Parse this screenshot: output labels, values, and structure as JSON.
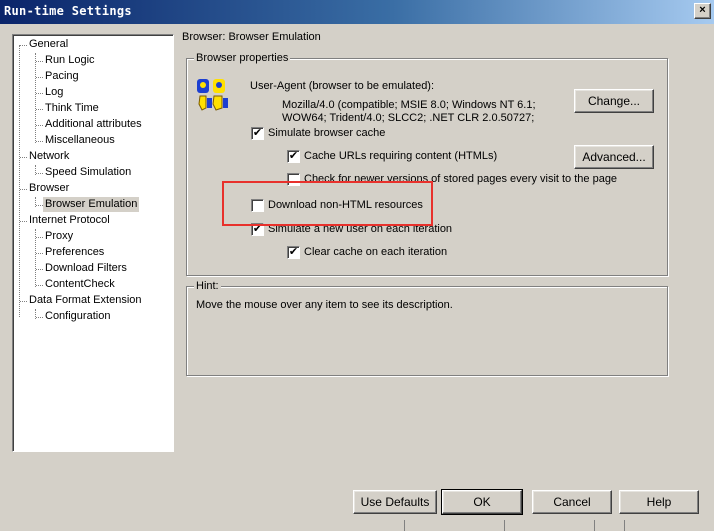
{
  "window": {
    "title": "Run-time Settings",
    "close_glyph": "×"
  },
  "tree": {
    "items": [
      {
        "label": "General"
      },
      {
        "label": "Run Logic"
      },
      {
        "label": "Pacing"
      },
      {
        "label": "Log"
      },
      {
        "label": "Think Time"
      },
      {
        "label": "Additional attributes"
      },
      {
        "label": "Miscellaneous"
      },
      {
        "label": "Network"
      },
      {
        "label": "Speed Simulation"
      },
      {
        "label": "Browser"
      },
      {
        "label": "Browser Emulation"
      },
      {
        "label": "Internet Protocol"
      },
      {
        "label": "Proxy"
      },
      {
        "label": "Preferences"
      },
      {
        "label": "Download Filters"
      },
      {
        "label": "ContentCheck"
      },
      {
        "label": "Data Format Extension"
      },
      {
        "label": "Configuration"
      }
    ],
    "selected": "Browser Emulation"
  },
  "panel": {
    "title": "Browser: Browser Emulation",
    "group_label": "Browser properties",
    "user_agent_label": "User-Agent (browser to be emulated):",
    "user_agent_line1": "Mozilla/4.0 (compatible; MSIE 8.0; Windows NT 6.1;",
    "user_agent_line2": "WOW64; Trident/4.0; SLCC2; .NET CLR 2.0.50727;",
    "change_button": "Change...",
    "advanced_button": "Advanced...",
    "options": {
      "simulate_cache": {
        "label": "Simulate browser cache",
        "checked": true
      },
      "cache_urls": {
        "label": "Cache URLs requiring content (HTMLs)",
        "checked": true
      },
      "check_newer": {
        "label": "Check for newer versions of stored pages every visit to the page",
        "checked": false
      },
      "download_non_html": {
        "label": "Download non-HTML resources",
        "checked": false
      },
      "new_user": {
        "label": "Simulate a new user on each iteration",
        "checked": true
      },
      "clear_cache": {
        "label": "Clear cache on each iteration",
        "checked": true
      }
    },
    "hint_label": "Hint:",
    "hint_text": "Move the mouse over any item to see its description."
  },
  "buttons": {
    "use_defaults": "Use Defaults",
    "ok": "OK",
    "cancel": "Cancel",
    "help": "Help"
  },
  "highlight_color": "#e8312c",
  "icons": {
    "user_agent": "browser-users-icon",
    "checkmark": "✔"
  }
}
